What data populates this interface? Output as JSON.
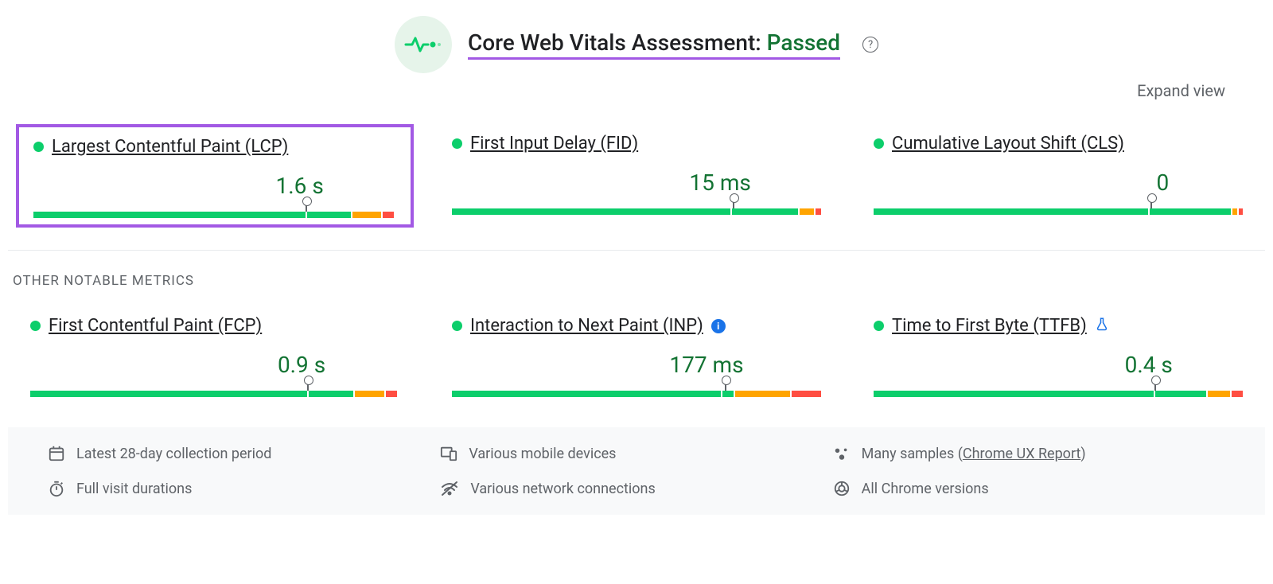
{
  "header": {
    "title_prefix": "Core Web Vitals Assessment: ",
    "status": "Passed"
  },
  "expand_view": "Expand view",
  "core_metrics": [
    {
      "name": "Largest Contentful Paint (LCP)",
      "value": "1.6 s",
      "marker_pct": 75,
      "segments": [
        75,
        12,
        8,
        3
      ],
      "highlighted": true
    },
    {
      "name": "First Input Delay (FID)",
      "value": "15 ms",
      "marker_pct": 76,
      "segments": [
        76,
        18,
        4,
        1.5
      ],
      "highlighted": false
    },
    {
      "name": "Cumulative Layout Shift (CLS)",
      "value": "0",
      "marker_pct": 75,
      "segments": [
        75,
        22,
        1.5,
        1
      ],
      "highlighted": false
    }
  ],
  "other_section_title": "OTHER NOTABLE METRICS",
  "other_metrics": [
    {
      "name": "First Contentful Paint (FCP)",
      "value": "0.9 s",
      "marker_pct": 75,
      "segments": [
        75,
        12,
        8,
        3
      ],
      "info": null
    },
    {
      "name": "Interaction to Next Paint (INP)",
      "value": "177 ms",
      "marker_pct": 74,
      "segments": [
        73,
        3,
        15,
        8
      ],
      "info": "info"
    },
    {
      "name": "Time to First Byte (TTFB)",
      "value": "0.4 s",
      "marker_pct": 76,
      "segments": [
        76,
        14,
        6,
        3
      ],
      "info": "lab"
    }
  ],
  "footer": {
    "period": "Latest 28-day collection period",
    "devices": "Various mobile devices",
    "samples_prefix": "Many samples (",
    "samples_link": "Chrome UX Report",
    "samples_suffix": ")",
    "durations": "Full visit durations",
    "network": "Various network connections",
    "versions": "All Chrome versions"
  }
}
